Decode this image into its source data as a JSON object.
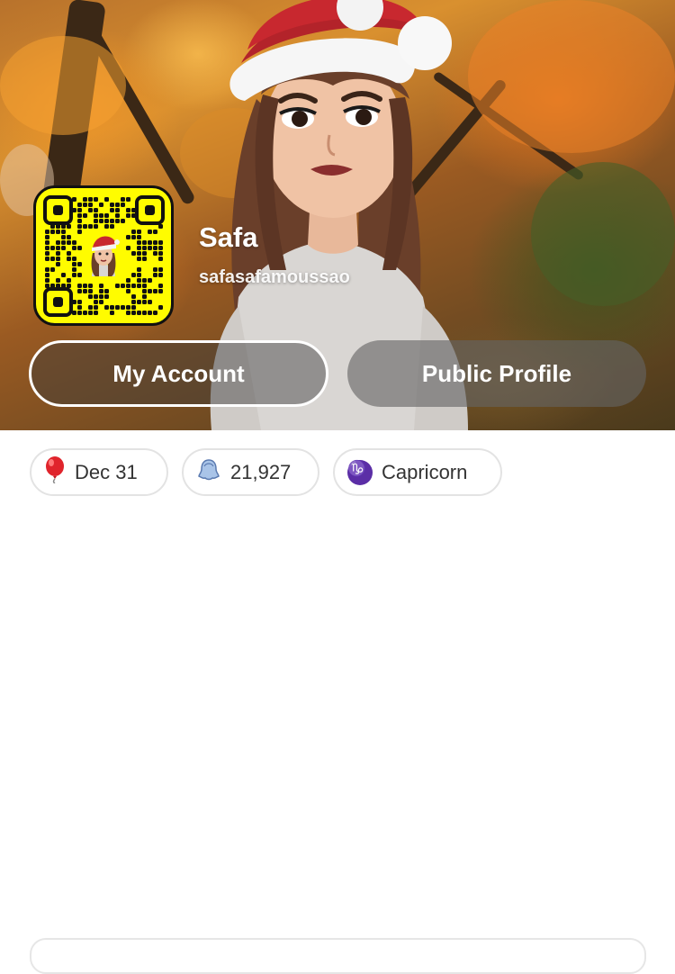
{
  "profile": {
    "display_name": "Safa",
    "username": "safasafamoussao"
  },
  "buttons": {
    "my_account": "My Account",
    "public_profile": "Public Profile"
  },
  "stats": {
    "birthday": {
      "icon": "balloon-icon",
      "value": "Dec 31"
    },
    "snap_score": {
      "icon": "ghost-icon",
      "value": "21,927"
    },
    "zodiac": {
      "icon": "capricorn-icon",
      "glyph": "♑",
      "value": "Capricorn"
    }
  },
  "colors": {
    "snapcode_yellow": "#fffc00",
    "zodiac_purple": "#5b2ea6",
    "chip_border": "#e3e3e3"
  }
}
